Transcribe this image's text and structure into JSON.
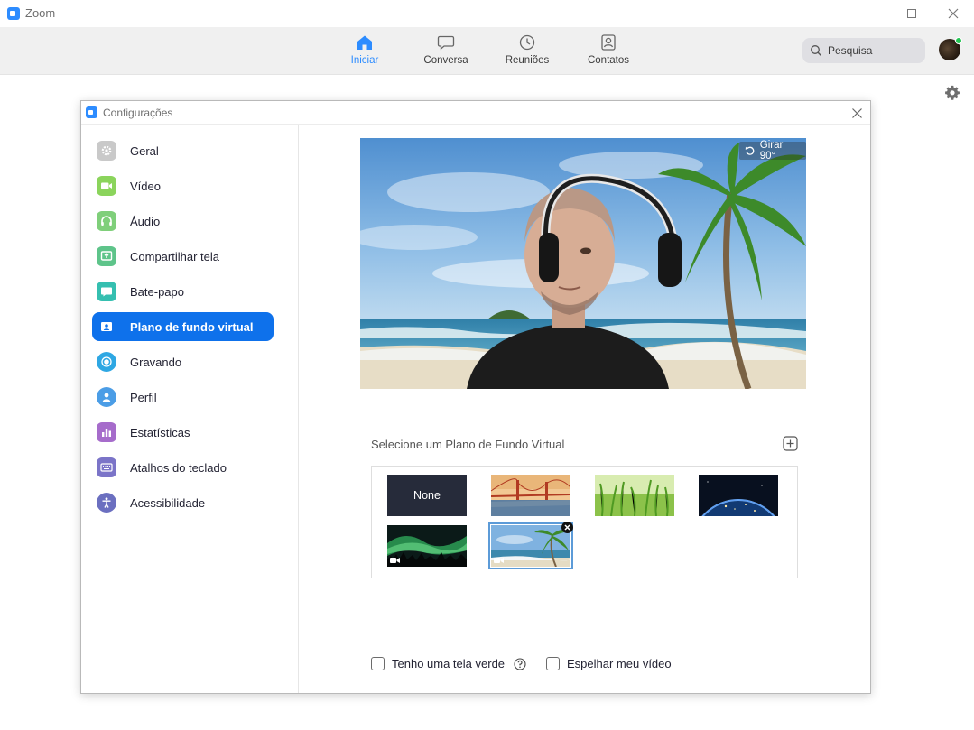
{
  "window": {
    "title": "Zoom"
  },
  "nav": {
    "items": [
      {
        "label": "Iniciar",
        "icon": "home-icon",
        "active": true
      },
      {
        "label": "Conversa",
        "icon": "chat-bubble-icon",
        "active": false
      },
      {
        "label": "Reuniões",
        "icon": "clock-icon",
        "active": false
      },
      {
        "label": "Contatos",
        "icon": "contacts-icon",
        "active": false
      }
    ],
    "search_placeholder": "Pesquisa"
  },
  "settings": {
    "title": "Configurações",
    "sidebar": [
      {
        "label": "Geral",
        "icon": "gear-icon",
        "color": "#c9c9c9"
      },
      {
        "label": "Vídeo",
        "icon": "video-camera-icon",
        "color": "#8bd45c"
      },
      {
        "label": "Áudio",
        "icon": "headphones-icon",
        "color": "#7fcf7a"
      },
      {
        "label": "Compartilhar tela",
        "icon": "share-screen-icon",
        "color": "#5ec48a"
      },
      {
        "label": "Bate-papo",
        "icon": "chat-icon",
        "color": "#35bfb0"
      },
      {
        "label": "Plano de fundo virtual",
        "icon": "virtual-background-icon",
        "color": "#0e71eb",
        "active": true
      },
      {
        "label": "Gravando",
        "icon": "record-icon",
        "color": "#2ea7e3"
      },
      {
        "label": "Perfil",
        "icon": "profile-icon",
        "color": "#4b9de6"
      },
      {
        "label": "Estatísticas",
        "icon": "statistics-icon",
        "color": "#a66ccb"
      },
      {
        "label": "Atalhos do teclado",
        "icon": "keyboard-icon",
        "color": "#7b74c8"
      },
      {
        "label": "Acessibilidade",
        "icon": "accessibility-icon",
        "color": "#6b6fc0"
      }
    ],
    "preview": {
      "rotate_label": "Girar 90°"
    },
    "select_label": "Selecione um Plano de Fundo Virtual",
    "backgrounds": [
      {
        "label": "None",
        "kind": "none"
      },
      {
        "name": "golden-gate-bridge",
        "kind": "image"
      },
      {
        "name": "grass",
        "kind": "image"
      },
      {
        "name": "earth-from-space",
        "kind": "image"
      },
      {
        "name": "aurora",
        "kind": "video"
      },
      {
        "name": "beach-palm",
        "kind": "video",
        "selected": true
      }
    ],
    "checkboxes": {
      "green_screen": "Tenho uma tela verde",
      "mirror": "Espelhar meu vídeo"
    }
  }
}
